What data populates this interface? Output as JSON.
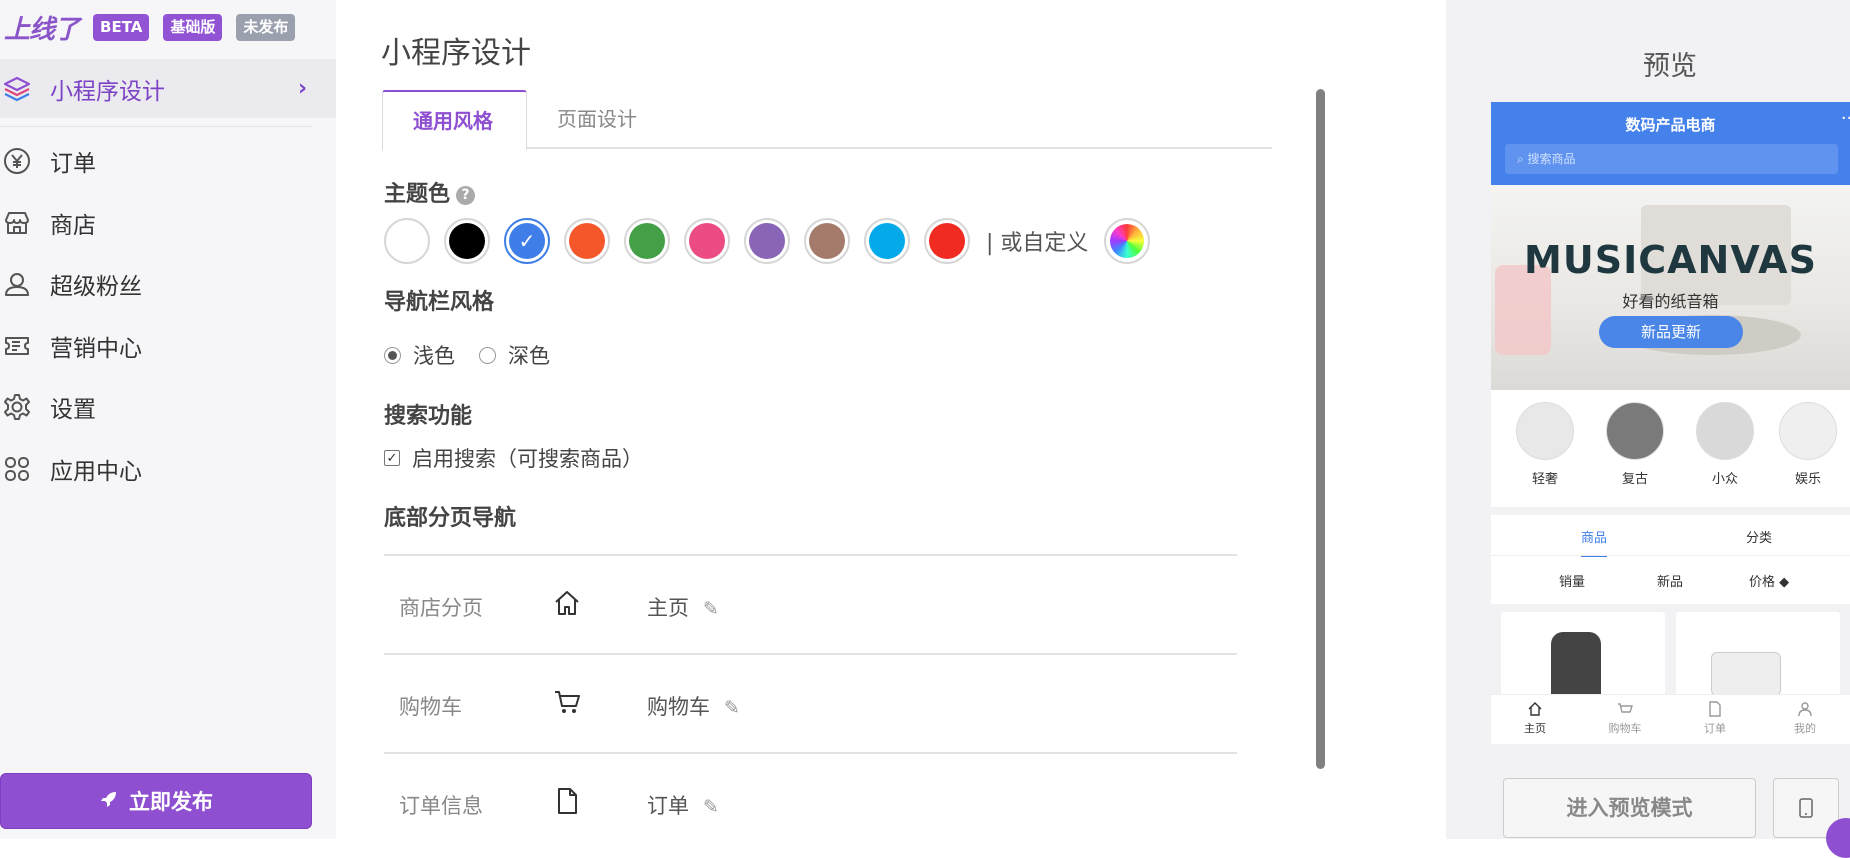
{
  "brand": {
    "logo_text": "上线了",
    "badges": [
      "BETA",
      "基础版",
      "未发布"
    ]
  },
  "sidebar": {
    "active_item": "小程序设计",
    "items": [
      {
        "label": "订单",
        "icon": "yen-circle-icon"
      },
      {
        "label": "商店",
        "icon": "store-icon"
      },
      {
        "label": "超级粉丝",
        "icon": "user-icon"
      },
      {
        "label": "营销中心",
        "icon": "ticket-icon"
      },
      {
        "label": "设置",
        "icon": "gear-icon"
      },
      {
        "label": "应用中心",
        "icon": "apps-icon"
      }
    ],
    "publish_label": "立即发布"
  },
  "main": {
    "title": "小程序设计",
    "tabs": [
      "通用风格",
      "页面设计"
    ],
    "theme": {
      "label": "主题色",
      "colors": [
        "#ffffff",
        "#000000",
        "#3f7ee8",
        "#f4572a",
        "#43a047",
        "#ec4c84",
        "#8a64b7",
        "#a47b6a",
        "#03a9e8",
        "#f02b22"
      ],
      "selected_color": "#3f7ee8",
      "custom_label": "| 或自定义"
    },
    "nav_style": {
      "label": "导航栏风格",
      "options": [
        "浅色",
        "深色"
      ],
      "selected": "浅色"
    },
    "search": {
      "label": "搜索功能",
      "checkbox_label": "启用搜索（可搜索商品）",
      "checked": true
    },
    "bottom_nav": {
      "label": "底部分页导航",
      "rows": [
        {
          "name": "商店分页",
          "icon": "home-icon",
          "text": "主页"
        },
        {
          "name": "购物车",
          "icon": "cart-icon",
          "text": "购物车"
        },
        {
          "name": "订单信息",
          "icon": "document-icon",
          "text": "订单"
        }
      ]
    }
  },
  "preview": {
    "title": "预览",
    "phone": {
      "store_title": "数码产品电商",
      "more": "···",
      "search_placeholder": "搜索商品",
      "banner_brand": "MUSICANVAS",
      "banner_sub": "好看的纸音箱",
      "banner_button": "新品更新",
      "categories": [
        "轻奢",
        "复古",
        "小众",
        "娱乐"
      ],
      "tabs": [
        "商品",
        "分类"
      ],
      "sort": [
        "销量",
        "新品",
        "价格 ◆"
      ],
      "tabbar": [
        "主页",
        "购物车",
        "订单",
        "我的"
      ]
    },
    "enter_preview_label": "进入预览模式"
  }
}
